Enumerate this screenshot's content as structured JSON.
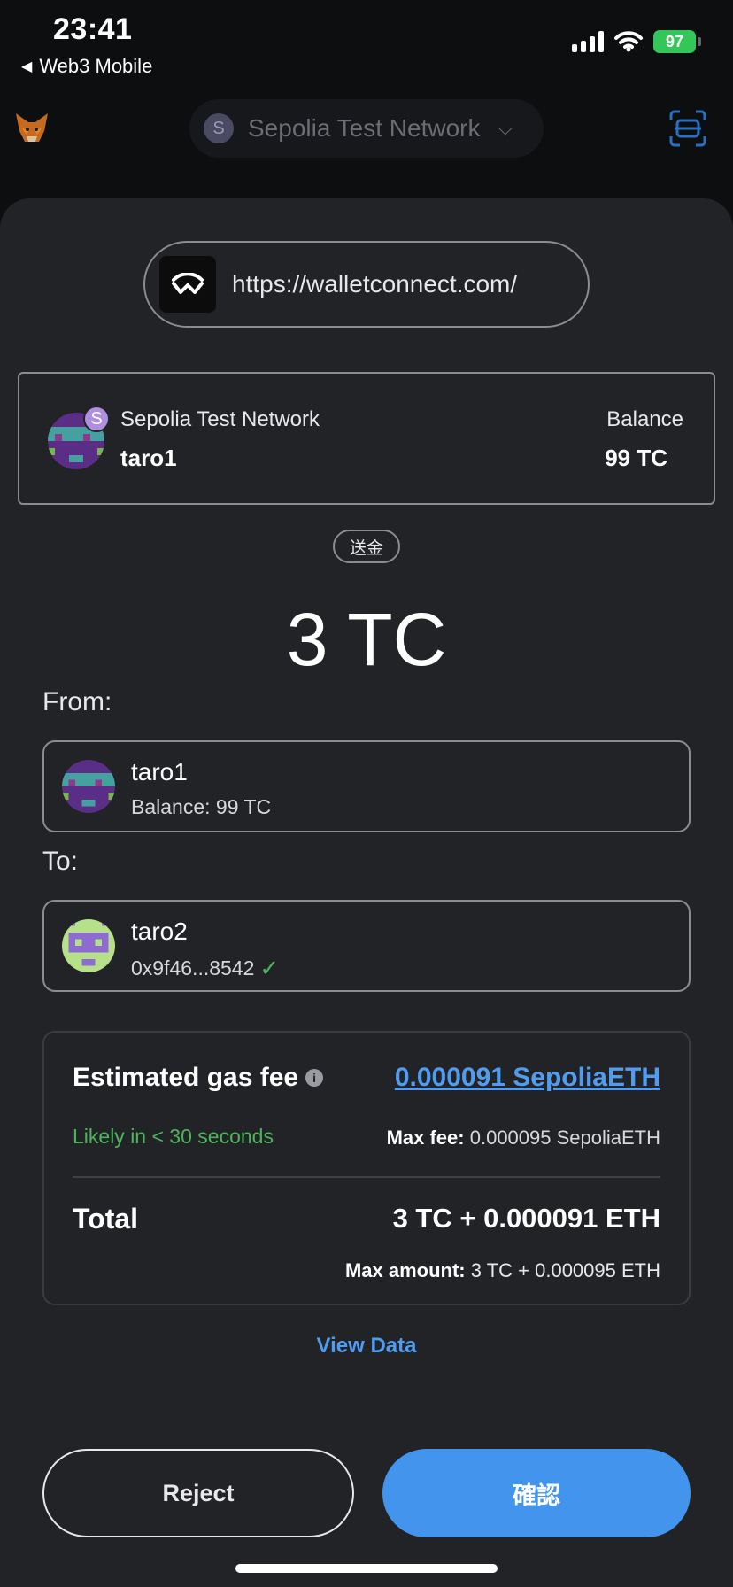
{
  "status_bar": {
    "time": "23:41",
    "back_label": "Web3 Mobile",
    "battery": "97"
  },
  "header": {
    "network_initial": "S",
    "network_name": "Sepolia Test Network"
  },
  "origin": {
    "url": "https://walletconnect.com/"
  },
  "account": {
    "network": "Sepolia Test Network",
    "network_badge": "S",
    "name": "taro1",
    "balance_label": "Balance",
    "balance_value": "99 TC"
  },
  "transaction": {
    "type_label": "送金",
    "amount": "3 TC",
    "from_label": "From:",
    "to_label": "To:",
    "from": {
      "name": "taro1",
      "detail": "Balance: 99 TC"
    },
    "to": {
      "name": "taro2",
      "detail": "0x9f46...8542"
    }
  },
  "fee": {
    "title": "Estimated gas fee",
    "value": "0.000091 SepoliaETH",
    "likely": "Likely in < 30 seconds",
    "max_fee_label": "Max fee:",
    "max_fee_value": "0.000095 SepoliaETH",
    "total_label": "Total",
    "total_value": "3 TC + 0.000091 ETH",
    "max_amount_label": "Max amount:",
    "max_amount_value": "3 TC + 0.000095 ETH"
  },
  "links": {
    "view_data": "View Data"
  },
  "actions": {
    "reject": "Reject",
    "confirm": "確認"
  },
  "colors": {
    "accent": "#4394ec",
    "success": "#4cb45a",
    "sheet_bg": "#222326",
    "page_bg": "#0d0e10"
  },
  "icons": [
    "metamask-fox-icon",
    "scan-qr-icon",
    "walletconnect-logo-icon",
    "info-icon",
    "check-icon",
    "chevron-down-icon",
    "back-triangle-icon",
    "signal-icon",
    "wifi-icon",
    "battery-icon"
  ]
}
